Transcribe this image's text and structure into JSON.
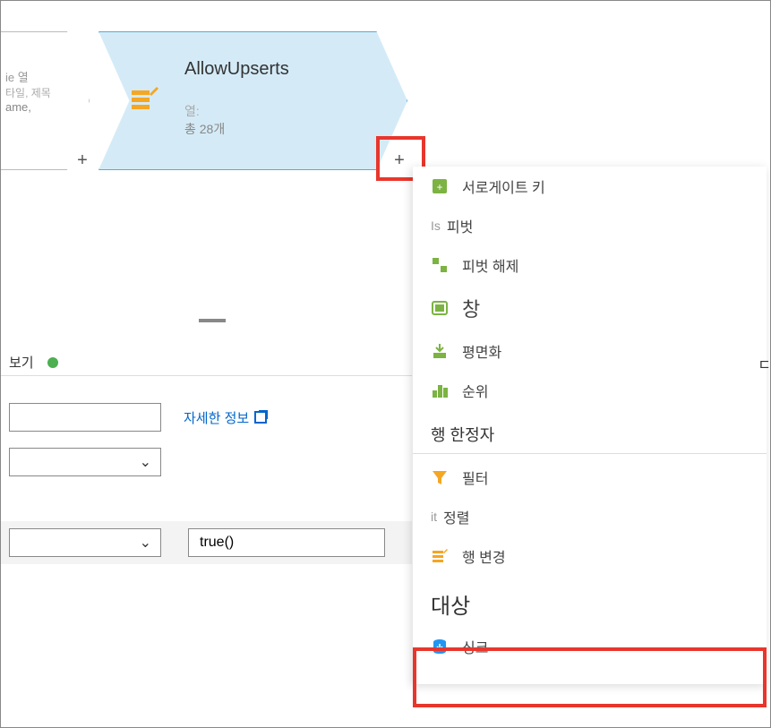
{
  "flow": {
    "leftNode": {
      "line1": "ie 열",
      "line2": "타일, 제목",
      "line3": "ame,"
    },
    "mainNode": {
      "title": "AllowUpserts",
      "subLabel": "열:",
      "subCount": "총 28개"
    }
  },
  "bottomPanel": {
    "viewLabel": "보기",
    "moreInfo": "자세한 정보",
    "trueExpr": "true()"
  },
  "contextMenu": {
    "surrogateKey": "서로게이트 키",
    "pivotPrefix": "Is",
    "pivot": "피벗",
    "unpivot": "피벗 해제",
    "window": "창",
    "flatten": "평면화",
    "rank": "순위",
    "rowModifierHeading": "행 한정자",
    "filter": "필터",
    "sortPrefix": "it",
    "sort": "정렬",
    "alterRow": "행 변경",
    "destinationHeading": "대상",
    "sink": "싱크"
  },
  "rightEdge": {
    "char": "ㄷ"
  }
}
